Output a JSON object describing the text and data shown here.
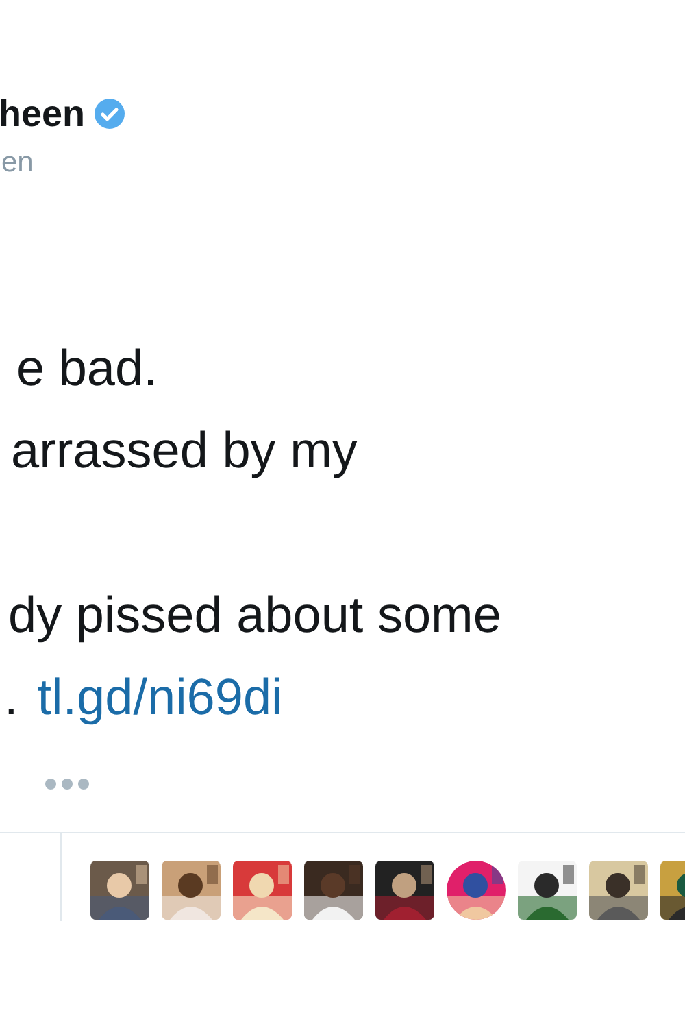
{
  "author": {
    "name": "heen",
    "verified": true,
    "handle": "en"
  },
  "tweet": {
    "paragraphs": [
      [
        "e bad.",
        "arrassed by my"
      ],
      [
        "dy pissed about some"
      ]
    ],
    "last_line_prefix": ".",
    "link": "tl.gd/ni69di"
  },
  "likers": [
    {
      "kind": "picture",
      "round": false
    },
    {
      "kind": "picture",
      "round": false
    },
    {
      "kind": "picture",
      "round": false
    },
    {
      "kind": "picture",
      "round": false
    },
    {
      "kind": "picture",
      "round": false
    },
    {
      "kind": "picture",
      "round": true
    },
    {
      "kind": "picture",
      "round": false
    },
    {
      "kind": "picture",
      "round": false
    },
    {
      "kind": "picture",
      "round": false
    }
  ]
}
